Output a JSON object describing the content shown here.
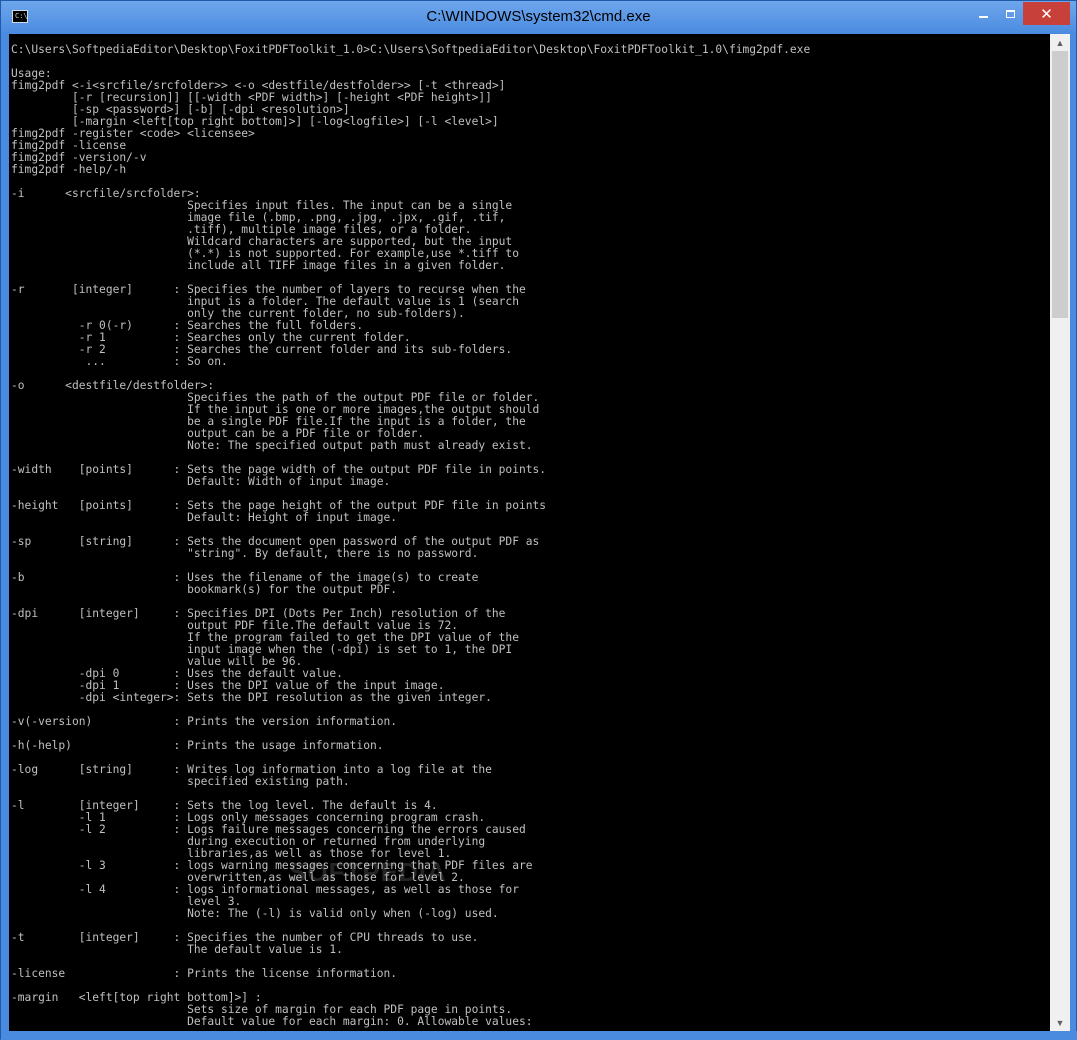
{
  "window": {
    "title": "C:\\WINDOWS\\system32\\cmd.exe",
    "app_icon_text": "C:\\",
    "minimize_icon": "minimize-icon",
    "maximize_icon": "maximize-icon",
    "close_label": "✕",
    "frame_color": "#4a8be0",
    "close_color": "#c7403a"
  },
  "console": {
    "background": "#000000",
    "foreground": "#c0c0c0",
    "lines": [
      "C:\\Users\\SoftpediaEditor\\Desktop\\FoxitPDFToolkit_1.0>C:\\Users\\SoftpediaEditor\\Desktop\\FoxitPDFToolkit_1.0\\fimg2pdf.exe",
      "",
      "Usage:",
      "fimg2pdf <-i<srcfile/srcfolder>> <-o <destfile/destfolder>> [-t <thread>]",
      "         [-r [recursion]] [[-width <PDF width>] [-height <PDF height>]]",
      "         [-sp <password>] [-b] [-dpi <resolution>]",
      "         [-margin <left[top right bottom]>] [-log<logfile>] [-l <level>]",
      "fimg2pdf -register <code> <licensee>",
      "fimg2pdf -license",
      "fimg2pdf -version/-v",
      "fimg2pdf -help/-h",
      "",
      "-i      <srcfile/srcfolder>:",
      "                          Specifies input files. The input can be a single",
      "                          image file (.bmp, .png, .jpg, .jpx, .gif, .tif,",
      "                          .tiff), multiple image files, or a folder.",
      "                          Wildcard characters are supported, but the input",
      "                          (*.*) is not supported. For example,use *.tiff to",
      "                          include all TIFF image files in a given folder.",
      "",
      "-r       [integer]      : Specifies the number of layers to recurse when the",
      "                          input is a folder. The default value is 1 (search",
      "                          only the current folder, no sub-folders).",
      "          -r 0(-r)      : Searches the full folders.",
      "          -r 1          : Searches only the current folder.",
      "          -r 2          : Searches the current folder and its sub-folders.",
      "           ...          : So on.",
      "",
      "-o      <destfile/destfolder>:",
      "                          Specifies the path of the output PDF file or folder.",
      "                          If the input is one or more images,the output should",
      "                          be a single PDF file.If the input is a folder, the",
      "                          output can be a PDF file or folder.",
      "                          Note: The specified output path must already exist.",
      "",
      "-width    [points]      : Sets the page width of the output PDF file in points.",
      "                          Default: Width of input image.",
      "",
      "-height   [points]      : Sets the page height of the output PDF file in points",
      "                          Default: Height of input image.",
      "",
      "-sp       [string]      : Sets the document open password of the output PDF as",
      "                          \"string\". By default, there is no password.",
      "",
      "-b                      : Uses the filename of the image(s) to create",
      "                          bookmark(s) for the output PDF.",
      "",
      "-dpi      [integer]     : Specifies DPI (Dots Per Inch) resolution of the",
      "                          output PDF file.The default value is 72.",
      "                          If the program failed to get the DPI value of the",
      "                          input image when the (-dpi) is set to 1, the DPI",
      "                          value will be 96.",
      "          -dpi 0        : Uses the default value.",
      "          -dpi 1        : Uses the DPI value of the input image.",
      "          -dpi <integer>: Sets the DPI resolution as the given integer.",
      "",
      "-v(-version)            : Prints the version information.",
      "",
      "-h(-help)               : Prints the usage information.",
      "",
      "-log      [string]      : Writes log information into a log file at the",
      "                          specified existing path.",
      "",
      "-l        [integer]     : Sets the log level. The default is 4.",
      "          -l 1          : Logs only messages concerning program crash.",
      "          -l 2          : Logs failure messages concerning the errors caused",
      "                          during execution or returned from underlying",
      "                          libraries,as well as those for level 1.",
      "          -l 3          : logs warning messages concerning that PDF files are",
      "                          overwritten,as well as those for level 2.",
      "          -l 4          : logs informational messages, as well as those for",
      "                          level 3.",
      "                          Note: The (-l) is valid only when (-log) used.",
      "",
      "-t        [integer]     : Specifies the number of CPU threads to use.",
      "                          The default value is 1.",
      "",
      "-license                : Prints the license information.",
      "",
      "-margin   <left[top right bottom]>] :",
      "                          Sets size of margin for each PDF page in points.",
      "                          Default value for each margin: 0. Allowable values:"
    ]
  },
  "watermark": "SOFTPEDIA",
  "scrollbar": {
    "up_icon": "▲",
    "down_icon": "▼",
    "position_fraction": 0
  }
}
